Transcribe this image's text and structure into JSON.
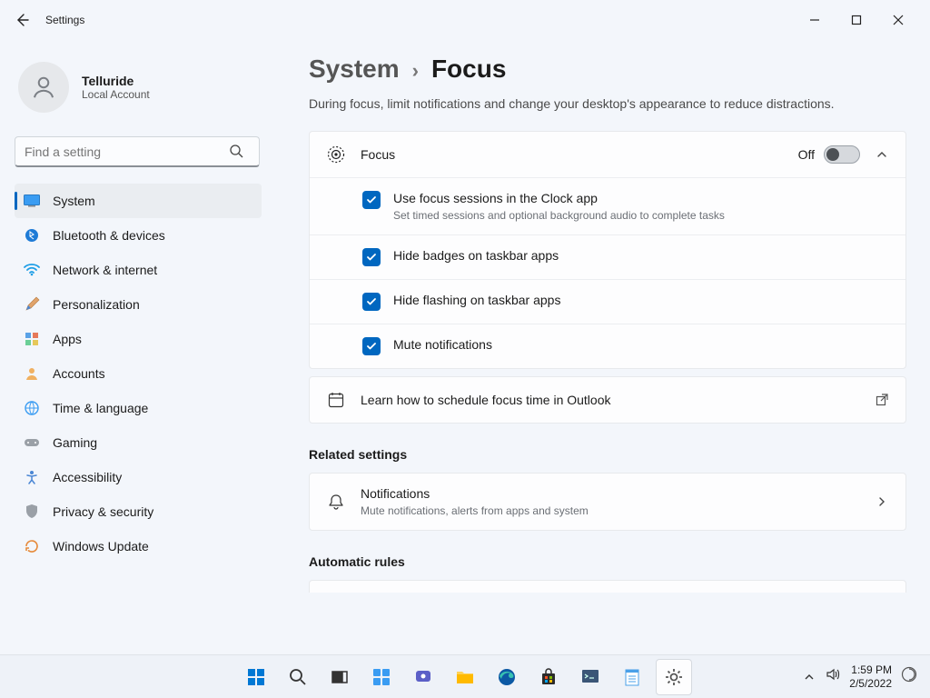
{
  "window": {
    "title": "Settings"
  },
  "account": {
    "name": "Telluride",
    "type": "Local Account"
  },
  "search": {
    "placeholder": "Find a setting"
  },
  "sidebar": {
    "items": [
      {
        "label": "System"
      },
      {
        "label": "Bluetooth & devices"
      },
      {
        "label": "Network & internet"
      },
      {
        "label": "Personalization"
      },
      {
        "label": "Apps"
      },
      {
        "label": "Accounts"
      },
      {
        "label": "Time & language"
      },
      {
        "label": "Gaming"
      },
      {
        "label": "Accessibility"
      },
      {
        "label": "Privacy & security"
      },
      {
        "label": "Windows Update"
      }
    ]
  },
  "breadcrumb": {
    "root": "System",
    "leaf": "Focus"
  },
  "subtitle": "During focus, limit notifications and change your desktop's appearance to reduce distractions.",
  "focus": {
    "title": "Focus",
    "toggle_state": "Off",
    "options": [
      {
        "label": "Use focus sessions in the Clock app",
        "sub": "Set timed sessions and optional background audio to complete tasks"
      },
      {
        "label": "Hide badges on taskbar apps"
      },
      {
        "label": "Hide flashing on taskbar apps"
      },
      {
        "label": "Mute notifications"
      }
    ],
    "learn": "Learn how to schedule focus time in Outlook"
  },
  "related": {
    "heading": "Related settings",
    "notifications": {
      "title": "Notifications",
      "sub": "Mute notifications, alerts from apps and system"
    }
  },
  "automatic": {
    "heading": "Automatic rules"
  },
  "tray": {
    "time": "1:59 PM",
    "date": "2/5/2022"
  }
}
